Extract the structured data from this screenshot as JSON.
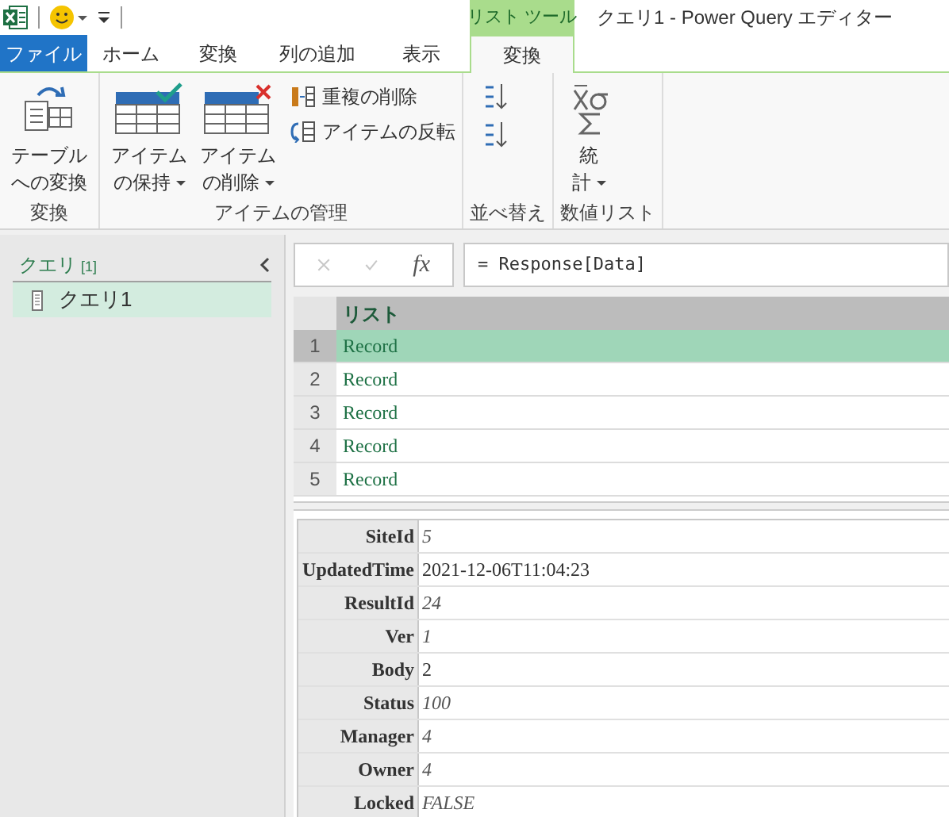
{
  "window": {
    "title": "クエリ1 - Power Query エディター",
    "context_label": "リスト ツール"
  },
  "tabs": [
    {
      "label": "ファイル",
      "kind": "file",
      "selected": false
    },
    {
      "label": "ホーム",
      "kind": "normal",
      "selected": false
    },
    {
      "label": "変換",
      "kind": "normal",
      "selected": false
    },
    {
      "label": "列の追加",
      "kind": "normal",
      "selected": false
    },
    {
      "label": "表示",
      "kind": "normal",
      "selected": false
    },
    {
      "label": "変換",
      "kind": "context",
      "selected": true
    }
  ],
  "ribbon": [
    {
      "label": "変換",
      "buttons": [
        {
          "kind": "large",
          "lines": [
            "テーブル",
            "への変換"
          ],
          "dropdown": false
        }
      ]
    },
    {
      "label": "アイテムの管理",
      "buttons": [
        {
          "kind": "large",
          "lines": [
            "アイテム",
            "の保持"
          ],
          "dropdown": true
        },
        {
          "kind": "large",
          "lines": [
            "アイテム",
            "の削除"
          ],
          "dropdown": true
        },
        {
          "kind": "small",
          "items": [
            {
              "label": "重複の削除"
            },
            {
              "label": "アイテムの反転"
            }
          ]
        }
      ]
    },
    {
      "label": "並べ替え",
      "buttons": [
        {
          "kind": "sort"
        }
      ]
    },
    {
      "label": "数値リスト",
      "buttons": [
        {
          "kind": "large",
          "lines": [
            "統",
            "計"
          ],
          "dropdown": true
        }
      ]
    }
  ],
  "queries": {
    "title": "クエリ",
    "count": "[1]",
    "items": [
      {
        "label": "クエリ1",
        "selected": true
      }
    ]
  },
  "formula_bar": {
    "fx": "fx",
    "formula": "= Response[Data]"
  },
  "table": {
    "column": "リスト",
    "rows": [
      {
        "index": "1",
        "value": "Record",
        "selected": true
      },
      {
        "index": "2",
        "value": "Record",
        "selected": false
      },
      {
        "index": "3",
        "value": "Record",
        "selected": false
      },
      {
        "index": "4",
        "value": "Record",
        "selected": false
      },
      {
        "index": "5",
        "value": "Record",
        "selected": false
      }
    ]
  },
  "record": [
    {
      "field": "SiteId",
      "value": "5",
      "kind": "number"
    },
    {
      "field": "UpdatedTime",
      "value": "2021-12-06T11:04:23",
      "kind": "text"
    },
    {
      "field": "ResultId",
      "value": "24",
      "kind": "number"
    },
    {
      "field": "Ver",
      "value": "1",
      "kind": "number"
    },
    {
      "field": "Body",
      "value": "2",
      "kind": "text"
    },
    {
      "field": "Status",
      "value": "100",
      "kind": "number"
    },
    {
      "field": "Manager",
      "value": "4",
      "kind": "number"
    },
    {
      "field": "Owner",
      "value": "4",
      "kind": "number"
    },
    {
      "field": "Locked",
      "value": "FALSE",
      "kind": "number"
    }
  ]
}
